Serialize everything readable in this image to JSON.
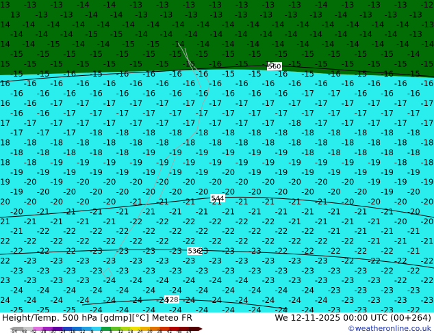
{
  "footer": {
    "product": "Height/Temp. 500 hPa [gdmp][°C] Meteo FR",
    "valid_time": "We 12-11-2025 00:00 UTC (00+264)",
    "credit": "©weatheronline.co.uk"
  },
  "colorbar": {
    "ticks": [
      "-54",
      "-48",
      "-42",
      "-38",
      "-30",
      "-24",
      "-18",
      "-12",
      "-8",
      "0",
      "8",
      "12",
      "18",
      "24",
      "30",
      "38",
      "42",
      "48",
      "54"
    ],
    "colors": [
      "#a0a0a0",
      "#c8c8c8",
      "#e070e0",
      "#a020c0",
      "#6000a0",
      "#2040c0",
      "#1070d0",
      "#20a0e0",
      "#30d0f0",
      "#10a040",
      "#60c020",
      "#b0d810",
      "#f0e000",
      "#f0b000",
      "#e07000",
      "#d03000",
      "#b00000",
      "#800000",
      "#500000"
    ]
  },
  "map": {
    "bands": [
      {
        "label": "-13 to -15",
        "color": "#036d05"
      },
      {
        "label": "-15 to -18",
        "color": "#2aeeee"
      },
      {
        "label": "-18 to -21",
        "color": "#3db3ef"
      },
      {
        "label": "-21 to -24",
        "color": "#3d8ee6"
      },
      {
        "label": "-24 to -25",
        "color": "#2b6bd4"
      }
    ],
    "isohypses": [
      "560",
      "544",
      "536",
      "528"
    ],
    "rows": [
      [
        "-13",
        "-13",
        "-13",
        "-14",
        "-14",
        "-13",
        "-13",
        "-13",
        "-13",
        "-13",
        "-13",
        "-13",
        "-14",
        "-13",
        "-13",
        "-13",
        "-12"
      ],
      [
        "13",
        "-13",
        "-13",
        "-14",
        "-14",
        "-13",
        "-13",
        "-13",
        "-13",
        "-13",
        "-13",
        "-13",
        "-13",
        "-14",
        "-13",
        "-13",
        "-13",
        "-13"
      ],
      [
        "-14",
        "-14",
        "-14",
        "-14",
        "-14",
        "-14",
        "-14",
        "-14",
        "-14",
        "-14",
        "-14",
        "-14",
        "-14",
        "-14",
        "-14",
        "-14",
        "-14",
        "-13"
      ],
      [
        "-14",
        "-14",
        "-14",
        "-15",
        "-15",
        "-14",
        "-14",
        "-14",
        "-14",
        "-14",
        "-14",
        "-14",
        "-14",
        "-14",
        "-14",
        "-14",
        "-13",
        "-13"
      ],
      [
        "-14",
        "-14",
        "-15",
        "-14",
        "-14",
        "-15",
        "-15",
        "-14",
        "-14",
        "-14",
        "-14",
        "-14",
        "-14",
        "-14",
        "-14",
        "-14",
        "-14",
        "-14"
      ],
      [
        "-15",
        "-15",
        "-15",
        "-15",
        "-15",
        "-15",
        "-15",
        "-15",
        "-15",
        "-15",
        "-15",
        "-15",
        "-15",
        "-15",
        "-15",
        "-14",
        "-15"
      ],
      [
        "-15",
        "-15",
        "-15",
        "-15",
        "-15",
        "-15",
        "-15",
        "-15",
        "-16",
        "-15",
        "-15",
        "-15",
        "-15",
        "-15",
        "-15",
        "-15",
        "-15"
      ],
      [
        "-15",
        "-15",
        "-16",
        "-15",
        "-16",
        "-16",
        "-16",
        "-16",
        "-15",
        "-15",
        "-16",
        "-15",
        "-16",
        "-15",
        "-16",
        "-15",
        "-15"
      ],
      [
        "-16",
        "-16",
        "-16",
        "-16",
        "-16",
        "-16",
        "-16",
        "-16",
        "-16",
        "-16",
        "-16",
        "-16",
        "-16",
        "-16",
        "-16",
        "-16",
        "-16"
      ],
      [
        "-16",
        "-16",
        "-16",
        "-16",
        "-16",
        "-16",
        "-16",
        "-16",
        "-16",
        "-16",
        "-16",
        "-17",
        "-17",
        "-16",
        "-16",
        "-16",
        "-16"
      ],
      [
        "-16",
        "-16",
        "-17",
        "-17",
        "-17",
        "-17",
        "-17",
        "-17",
        "-17",
        "-17",
        "-17",
        "-17",
        "-17",
        "-17",
        "-17",
        "-17",
        "-17"
      ],
      [
        "-16",
        "-16",
        "-17",
        "-17",
        "-17",
        "-17",
        "-17",
        "-17",
        "-17",
        "-17",
        "-17",
        "-17",
        "-17",
        "-17",
        "-17",
        "-17",
        "-17"
      ],
      [
        "-17",
        "-17",
        "-17",
        "-17",
        "-17",
        "-17",
        "-17",
        "-17",
        "-17",
        "-17",
        "-17",
        "-18",
        "-17",
        "-17",
        "-17",
        "-17",
        "-17"
      ],
      [
        "-17",
        "-17",
        "-17",
        "-18",
        "-18",
        "-18",
        "-18",
        "-18",
        "-18",
        "-18",
        "-18",
        "-18",
        "-18",
        "-18",
        "-18",
        "-18",
        "-18"
      ],
      [
        "-18",
        "-18",
        "-18",
        "-18",
        "-18",
        "-18",
        "-18",
        "-18",
        "-18",
        "-18",
        "-18",
        "-18",
        "-18",
        "-18",
        "-18",
        "-18",
        "-18"
      ],
      [
        "-18",
        "-18",
        "-18",
        "-18",
        "-18",
        "-19",
        "-19",
        "-19",
        "-19",
        "-19",
        "-19",
        "-18",
        "-18",
        "-18",
        "-18",
        "-18",
        "-18"
      ],
      [
        "-18",
        "-18",
        "-19",
        "-19",
        "-19",
        "-19",
        "-19",
        "-19",
        "-19",
        "-19",
        "-19",
        "-19",
        "-19",
        "-19",
        "-19",
        "-18",
        "-18"
      ],
      [
        "-19",
        "-19",
        "-19",
        "-19",
        "-19",
        "-19",
        "-19",
        "-19",
        "-20",
        "-19",
        "-19",
        "-19",
        "-19",
        "-19",
        "-19",
        "-19",
        "-18"
      ],
      [
        "-19",
        "-20",
        "-19",
        "-20",
        "-20",
        "-20",
        "-20",
        "-20",
        "-20",
        "-20",
        "-20",
        "-20",
        "-20",
        "-20",
        "-19",
        "-19",
        "-19"
      ],
      [
        "-19",
        "-20",
        "-20",
        "-20",
        "-20",
        "-20",
        "-20",
        "-20",
        "-20",
        "-20",
        "-20",
        "-20",
        "-20",
        "-20",
        "-19",
        "-20",
        "-19"
      ],
      [
        "-20",
        "-20",
        "-20",
        "-20",
        "-20",
        "-21",
        "-21",
        "-21",
        "-21",
        "-21",
        "-21",
        "-21",
        "-21",
        "-20",
        "-20",
        "-20",
        "-20"
      ],
      [
        "-20",
        "-21",
        "-21",
        "-21",
        "-21",
        "-21",
        "-21",
        "-21",
        "-21",
        "-21",
        "-21",
        "-21",
        "-21",
        "-21",
        "-21",
        "-20",
        "-20"
      ],
      [
        "-21",
        "-21",
        "-21",
        "-21",
        "-21",
        "-22",
        "-22",
        "-22",
        "-22",
        "-22",
        "-22",
        "-21",
        "-21",
        "-21",
        "-21",
        "-20",
        "-20"
      ],
      [
        "-21",
        "-22",
        "-22",
        "-22",
        "-22",
        "-22",
        "-22",
        "-22",
        "-22",
        "-22",
        "-22",
        "-22",
        "-21",
        "-21",
        "-21",
        "-21",
        "-21"
      ],
      [
        "-22",
        "-22",
        "-22",
        "-22",
        "-22",
        "-22",
        "-22",
        "-22",
        "-22",
        "-22",
        "-22",
        "-22",
        "-22",
        "-22",
        "-21",
        "-21",
        "-21"
      ],
      [
        "-22",
        "-22",
        "-22",
        "-23",
        "-23",
        "-23",
        "-23",
        "-23",
        "-23",
        "-23",
        "-22",
        "-22",
        "-22",
        "-22",
        "-22",
        "-21",
        "-21"
      ],
      [
        "-22",
        "-23",
        "-23",
        "-23",
        "-23",
        "-23",
        "-23",
        "-23",
        "-23",
        "-23",
        "-23",
        "-23",
        "-23",
        "-22",
        "-22",
        "-22",
        "-22"
      ],
      [
        "-23",
        "-23",
        "-23",
        "-23",
        "-23",
        "-23",
        "-23",
        "-23",
        "-23",
        "-23",
        "-23",
        "-23",
        "-23",
        "-23",
        "-22",
        "-22",
        "-22"
      ],
      [
        "-23",
        "-23",
        "-23",
        "-23",
        "-24",
        "-24",
        "-24",
        "-24",
        "-24",
        "-24",
        "-23",
        "-23",
        "-23",
        "-23",
        "-23",
        "-22",
        "-22"
      ],
      [
        "-24",
        "-24",
        "-24",
        "-24",
        "-24",
        "-24",
        "-24",
        "-24",
        "-24",
        "-24",
        "-24",
        "-24",
        "-23",
        "-23",
        "-23",
        "-23",
        "-23"
      ],
      [
        "-24",
        "-24",
        "-24",
        "-24",
        "-24",
        "-24",
        "-24",
        "-24",
        "-24",
        "-24",
        "-24",
        "-24",
        "-24",
        "-23",
        "-23",
        "-23",
        "-23"
      ],
      [
        "-25",
        "-25",
        "-25",
        "-24",
        "-24",
        "-24",
        "-24",
        "-24",
        "-24",
        "-24",
        "-24",
        "-24",
        "-23",
        "-23",
        "-23",
        "-22",
        "-22"
      ]
    ]
  }
}
